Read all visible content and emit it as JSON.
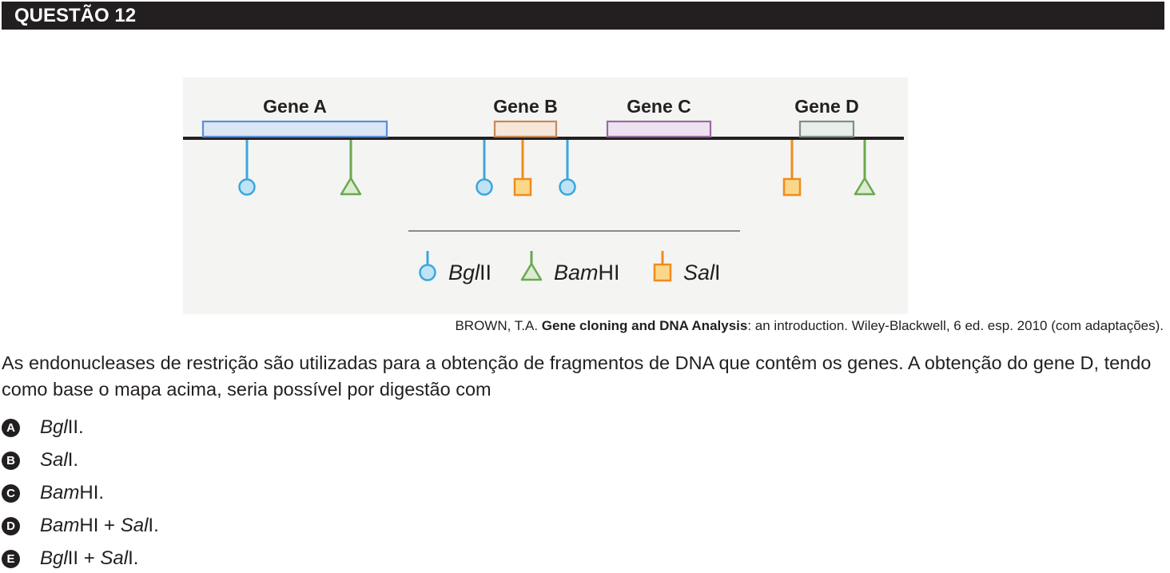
{
  "header": {
    "title": "QUESTÃO 12"
  },
  "figure": {
    "genes": [
      {
        "label": "Gene A",
        "color": "#5b8fd6",
        "fill": "#dbe6f5"
      },
      {
        "label": "Gene B",
        "color": "#c48a5a",
        "fill": "#f6e7da"
      },
      {
        "label": "Gene C",
        "color": "#9a6aa3",
        "fill": "#efe2f0"
      },
      {
        "label": "Gene D",
        "color": "#7f8f86",
        "fill": "#e9eeea"
      }
    ],
    "sites": [
      "BglII",
      "BamHI",
      "BglII",
      "SalI",
      "BglII",
      "SalI",
      "BamHI"
    ],
    "legend": [
      {
        "enzyme": "BglII",
        "italic": "Bgl",
        "rest": "II",
        "shape": "circle",
        "color": "#3aa7dc",
        "fill": "#bfe3f5"
      },
      {
        "enzyme": "BamHI",
        "italic": "Bam",
        "rest": "HI",
        "shape": "triangle",
        "color": "#6aa84f",
        "fill": "#dcebd1"
      },
      {
        "enzyme": "SalI",
        "italic": "Sal",
        "rest": "I",
        "shape": "square",
        "color": "#f08c1c",
        "fill": "#fbd78a"
      }
    ]
  },
  "caption": {
    "author": "BROWN, T.A. ",
    "title": "Gene cloning and DNA Analysis",
    "rest": ": an introduction. Wiley-Blackwell, 6 ed. esp. 2010 (com adaptações)."
  },
  "stem": "As endonucleases de restrição são utilizadas para a obtenção de fragmentos de DNA que contêm os genes. A obtenção do gene D, tendo como base o mapa acima, seria possível por digestão com",
  "options": [
    {
      "letter": "A",
      "parts": [
        {
          "t": "Bgl",
          "i": true
        },
        {
          "t": "II.",
          "i": false
        }
      ]
    },
    {
      "letter": "B",
      "parts": [
        {
          "t": "Sal",
          "i": true
        },
        {
          "t": "I.",
          "i": false
        }
      ]
    },
    {
      "letter": "C",
      "parts": [
        {
          "t": "Bam",
          "i": true
        },
        {
          "t": "HI.",
          "i": false
        }
      ]
    },
    {
      "letter": "D",
      "parts": [
        {
          "t": "Bam",
          "i": true
        },
        {
          "t": "HI + ",
          "i": false
        },
        {
          "t": "Sal",
          "i": true
        },
        {
          "t": "I.",
          "i": false
        }
      ]
    },
    {
      "letter": "E",
      "parts": [
        {
          "t": "Bgl",
          "i": true
        },
        {
          "t": "II + ",
          "i": false
        },
        {
          "t": "Sal",
          "i": true
        },
        {
          "t": "I.",
          "i": false
        }
      ]
    }
  ]
}
